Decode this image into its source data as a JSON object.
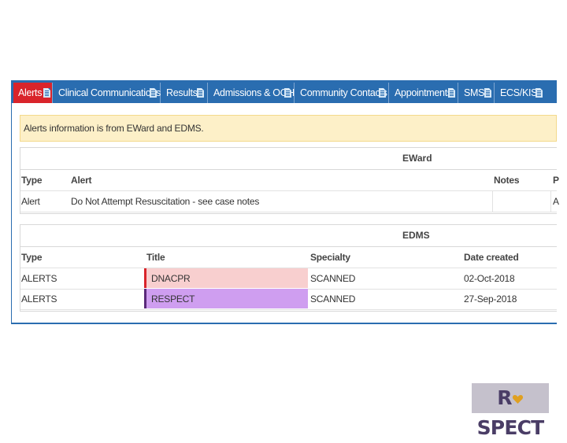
{
  "tabs": [
    {
      "label": "Alerts",
      "active": true
    },
    {
      "label": "Clinical Communications",
      "active": false
    },
    {
      "label": "Results",
      "active": false
    },
    {
      "label": "Admissions & OOH",
      "active": false
    },
    {
      "label": "Community Contacts",
      "active": false
    },
    {
      "label": "Appointments",
      "active": false
    },
    {
      "label": "SMS",
      "active": false
    },
    {
      "label": "ECS/KIS",
      "active": false
    }
  ],
  "info_message": "Alerts information is from EWard and EDMS.",
  "eward": {
    "title": "EWard",
    "headers": {
      "type": "Type",
      "alert": "Alert",
      "notes": "Notes",
      "extra": "P"
    },
    "rows": [
      {
        "type": "Alert",
        "alert": "Do Not Attempt Resuscitation - see case notes",
        "notes": "",
        "extra": "A"
      }
    ]
  },
  "edms": {
    "title": "EDMS",
    "headers": {
      "type": "Type",
      "title": "Title",
      "specialty": "Specialty",
      "date": "Date created"
    },
    "rows": [
      {
        "type": "ALERTS",
        "title": "DNACPR",
        "specialty": "SCANNED",
        "date": "02-Oct-2018",
        "highlight": "#f8cfcf",
        "marker": "#d9242b"
      },
      {
        "type": "ALERTS",
        "title": "RESPECT",
        "specialty": "SCANNED",
        "date": "27-Sep-2018",
        "highlight": "#cf9ef0",
        "marker": "#5a2a7a"
      }
    ]
  },
  "logo": {
    "pre": "R",
    "post": "SPECT",
    "heart_color": "#e0a020"
  }
}
